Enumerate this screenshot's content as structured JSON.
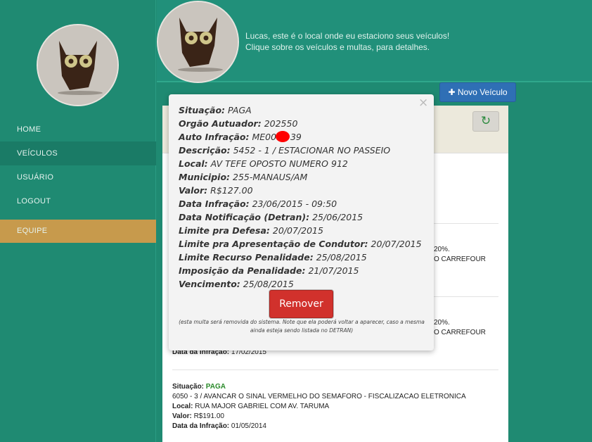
{
  "sidebar": {
    "items": [
      {
        "label": "HOME"
      },
      {
        "label": "VEÍCULOS"
      },
      {
        "label": "USUÁRIO"
      },
      {
        "label": "LOGOUT"
      },
      {
        "label": "EQUIPE"
      }
    ]
  },
  "header": {
    "line1": "Lucas, este é o local onde eu estaciono seus veículos!",
    "line2": "Clique sobre os veículos e multas, para detalhes."
  },
  "toolbar": {
    "novo_label": "Novo Veículo",
    "refresh_icon": "refresh-icon"
  },
  "background_list": {
    "partial_texts": [
      "20%.",
      "O CARREFOUR",
      "20%.",
      "O CARREFOUR"
    ],
    "item2_data_label": "Data da Infração:",
    "item2_data_value": "17/02/2015",
    "item3": {
      "situacao_label": "Situação:",
      "situacao_value": "PAGA",
      "descricao": "6050 - 3 / AVANCAR O SINAL VERMELHO DO SEMAFORO - FISCALIZACAO ELETRONICA",
      "local_label": "Local:",
      "local_value": "RUA MAJOR GABRIEL COM AV. TARUMA",
      "valor_label": "Valor:",
      "valor_value": "R$191.00",
      "data_label": "Data da Infração:",
      "data_value": "01/05/2014"
    }
  },
  "modal": {
    "close": "×",
    "rows": [
      {
        "label": "Situação:",
        "value": "PAGA"
      },
      {
        "label": "Orgão Autuador:",
        "value": "202550"
      },
      {
        "label": "Auto Infração:",
        "value": "ME0000  39"
      },
      {
        "label": "Descrição:",
        "value": "5452 - 1 / ESTACIONAR NO PASSEIO"
      },
      {
        "label": "Local:",
        "value": "AV TEFE OPOSTO NUMERO 912"
      },
      {
        "label": "Municipio:",
        "value": "255-MANAUS/AM"
      },
      {
        "label": "Valor:",
        "value": "R$127.00"
      },
      {
        "label": "Data Infração:",
        "value": "23/06/2015 - 09:50"
      },
      {
        "label": "Data Notificação (Detran):",
        "value": "25/06/2015"
      },
      {
        "label": "Limite pra Defesa:",
        "value": "20/07/2015"
      },
      {
        "label": "Limite pra Apresentação de Condutor:",
        "value": "20/07/2015"
      },
      {
        "label": "Limite Recurso Penalidade:",
        "value": "25/08/2015"
      },
      {
        "label": "Imposição da Penalidade:",
        "value": "21/07/2015"
      },
      {
        "label": "Vencimento:",
        "value": "25/08/2015"
      }
    ],
    "remover_label": "Remover",
    "note": "(esta multa será removida do sistema. Note que ela poderá voltar a aparecer, caso a mesma ainda esteja sendo listada no DETRAN)"
  },
  "colors": {
    "brand_green": "#1f8a72",
    "equipe_gold": "#c79a4c",
    "primary_blue": "#2f6fb5",
    "danger_red": "#d1312c"
  }
}
